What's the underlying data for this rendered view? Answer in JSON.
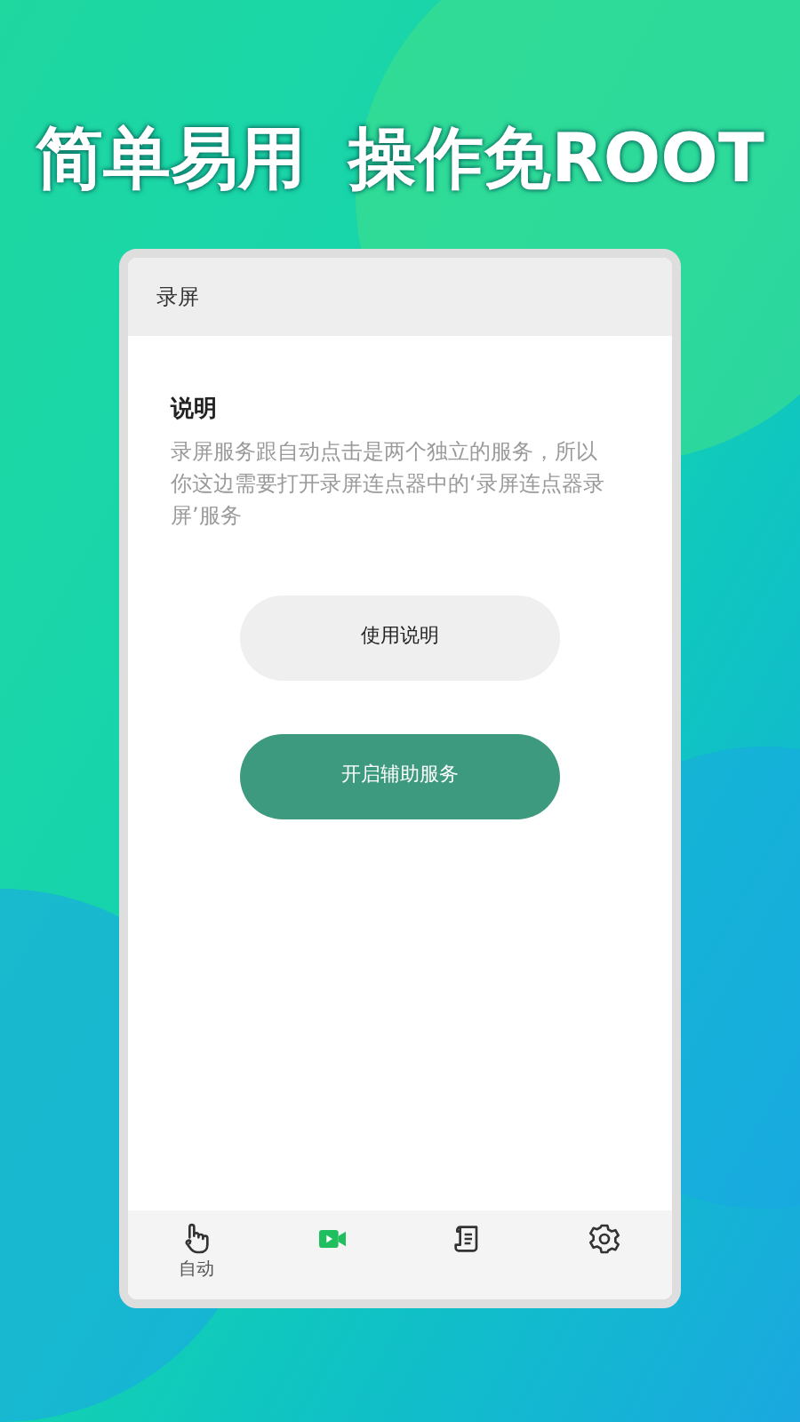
{
  "headline": {
    "part_1": "简单易用",
    "part_2": "操作免ROOT"
  },
  "window": {
    "title": "录屏"
  },
  "notice": {
    "heading": "说明",
    "body": "录屏服务跟自动点击是两个独立的服务，所以你这边需要打开录屏连点器中的‘录屏连点器录屏’服务"
  },
  "buttons": [
    {
      "label": "使用说明",
      "kind": "secondary"
    },
    {
      "label": "开启辅助服务",
      "kind": "primary"
    }
  ],
  "tabs": [
    {
      "kind": "hand",
      "label": "自动",
      "selected": false
    },
    {
      "kind": "video",
      "selected": true
    },
    {
      "kind": "scroll",
      "selected": false
    },
    {
      "kind": "gear",
      "selected": false
    }
  ]
}
